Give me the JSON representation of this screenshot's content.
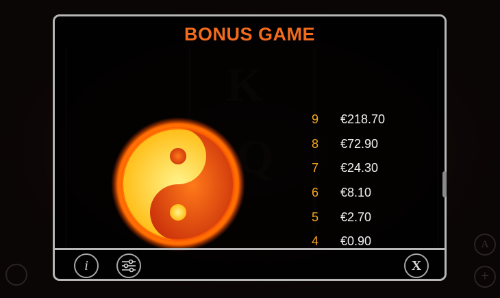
{
  "modal": {
    "title": "BONUS GAME",
    "symbol_icon": "yin-yang-sun-icon",
    "paytable": [
      {
        "count": "9",
        "value": "€218.70"
      },
      {
        "count": "8",
        "value": "€72.90"
      },
      {
        "count": "7",
        "value": "€24.30"
      },
      {
        "count": "6",
        "value": "€8.10"
      },
      {
        "count": "5",
        "value": "€2.70"
      },
      {
        "count": "4",
        "value": "€0.90"
      }
    ]
  },
  "footer": {
    "info_icon": "info-icon",
    "settings_icon": "sliders-icon",
    "close_icon": "close-icon",
    "info_glyph": "i",
    "close_glyph": "X"
  },
  "background": {
    "side_button_a": "A",
    "side_button_plus": "+"
  },
  "colors": {
    "title": "#f26b1d",
    "pay_count": "#f5a81e",
    "pay_value": "#f2f2f2",
    "border": "#b7b7b7"
  }
}
